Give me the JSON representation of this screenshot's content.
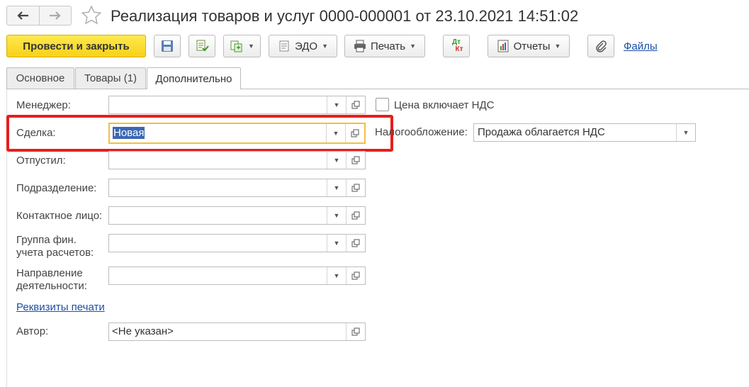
{
  "window": {
    "title": "Реализация товаров и услуг 0000-000001 от 23.10.2021 14:51:02"
  },
  "toolbar": {
    "post_and_close_label": "Провести и закрыть",
    "edo_label": "ЭДО",
    "print_label": "Печать",
    "dt_kt_label_top": "Дт",
    "dt_kt_label_bottom": "Кт",
    "reports_label": "Отчеты",
    "files_link": "Файлы"
  },
  "tabs": [
    {
      "label": "Основное",
      "active": false
    },
    {
      "label": "Товары (1)",
      "active": false
    },
    {
      "label": "Дополнительно",
      "active": true
    }
  ],
  "form": {
    "manager": {
      "label": "Менеджер:",
      "value": ""
    },
    "deal": {
      "label": "Сделка:",
      "value": "Новая"
    },
    "released_by": {
      "label": "Отпустил:",
      "value": ""
    },
    "department": {
      "label": "Подразделение:",
      "value": ""
    },
    "contact_person": {
      "label": "Контактное лицо:",
      "value": ""
    },
    "fin_group": {
      "label_line1": "Группа фин.",
      "label_line2": "учета расчетов:",
      "value": ""
    },
    "activity_direction": {
      "label_line1": "Направление",
      "label_line2": "деятельности:",
      "value": ""
    },
    "print_requisites_link": "Реквизиты печати",
    "author": {
      "label": "Автор:",
      "value": "<Не указан>"
    },
    "price_includes_vat": {
      "label": "Цена включает НДС",
      "checked": false
    },
    "taxation": {
      "label": "Налогообложение:",
      "value": "Продажа облагается НДС"
    }
  },
  "colors": {
    "primary_button": "#f7d11b",
    "highlight_frame": "#e51e1e",
    "link": "#1c4fa3",
    "selection": "#3b68b5",
    "focus_border": "#f0c040"
  }
}
